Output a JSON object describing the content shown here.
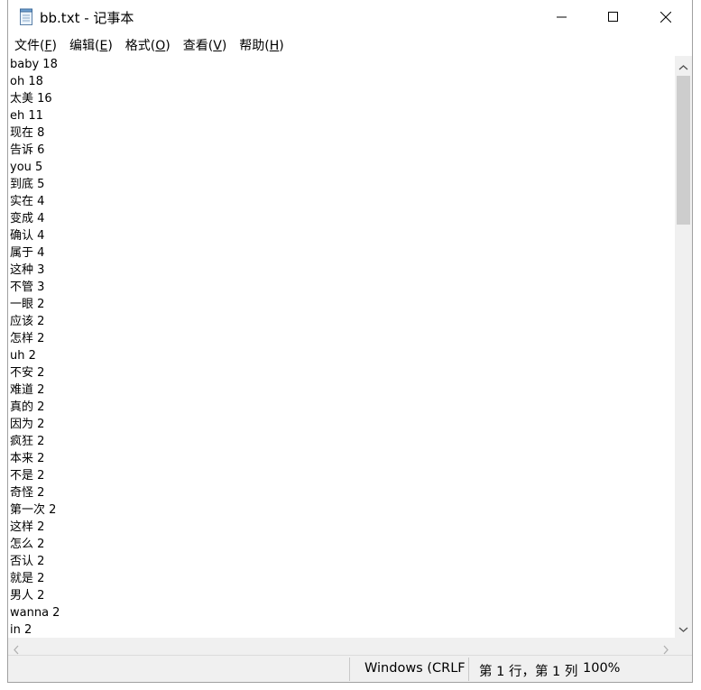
{
  "window": {
    "title": "bb.txt - 记事本"
  },
  "menu": [
    {
      "label": "文件(",
      "key": "F",
      "suffix": ")"
    },
    {
      "label": "编辑(",
      "key": "E",
      "suffix": ")"
    },
    {
      "label": "格式(",
      "key": "O",
      "suffix": ")"
    },
    {
      "label": "查看(",
      "key": "V",
      "suffix": ")"
    },
    {
      "label": "帮助(",
      "key": "H",
      "suffix": ")"
    }
  ],
  "editor": {
    "lines": [
      "baby 18",
      "oh 18",
      "太美 16",
      "eh 11",
      "现在 8",
      "告诉 6",
      "you 5",
      "到底 5",
      "实在 4",
      "变成 4",
      "确认 4",
      "属于 4",
      "这种 3",
      "不管 3",
      "一眼 2",
      "应该 2",
      "怎样 2",
      "uh 2",
      "不安 2",
      "难道 2",
      "真的 2",
      "因为 2",
      "疯狂 2",
      "本来 2",
      "不是 2",
      "奇怪 2",
      "第一次 2",
      "这样 2",
      "怎么 2",
      "否认 2",
      "就是 2",
      "男人 2",
      "wanna 2",
      "in 2"
    ]
  },
  "statusbar": {
    "encoding": "Windows (CRLF)",
    "position": "第 1 行，第 1 列",
    "zoom": "100%"
  },
  "icons": {
    "app": "notepad-icon",
    "minimize": "minimize-icon",
    "maximize": "maximize-icon",
    "close": "close-icon"
  },
  "colors": {
    "chrome": "#f0f0f0",
    "scroll_thumb": "#cdcdcd"
  }
}
